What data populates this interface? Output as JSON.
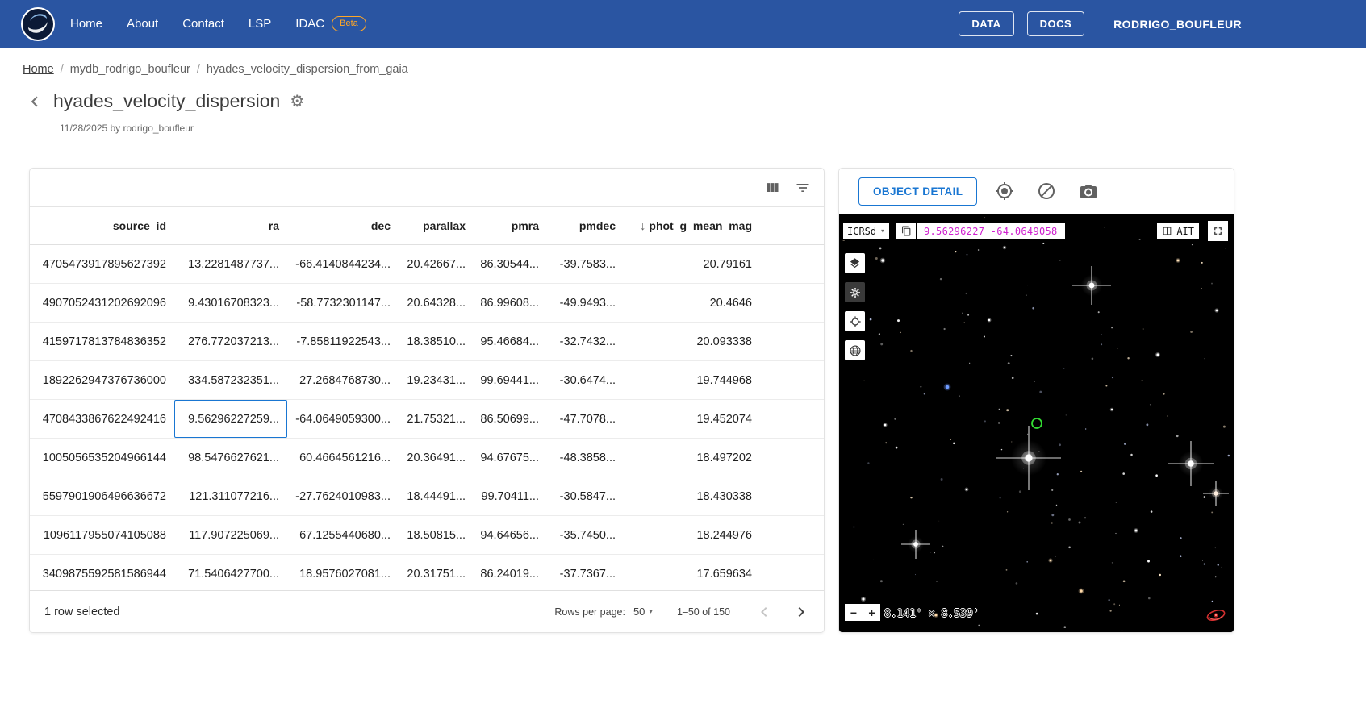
{
  "navbar": {
    "items": [
      {
        "label": "Home"
      },
      {
        "label": "About"
      },
      {
        "label": "Contact"
      },
      {
        "label": "LSP"
      },
      {
        "label": "IDAC",
        "badge": "Beta"
      }
    ],
    "actions": [
      {
        "label": "DATA"
      },
      {
        "label": "DOCS"
      }
    ],
    "user": "RODRIGO_BOUFLEUR"
  },
  "breadcrumb": {
    "separator": "/",
    "items": [
      {
        "label": "Home",
        "link": true
      },
      {
        "label": "mydb_rodrigo_boufleur"
      },
      {
        "label": "hyades_velocity_dispersion_from_gaia"
      }
    ]
  },
  "page": {
    "title": "hyades_velocity_dispersion",
    "date_author": "11/28/2025 by rodrigo_boufleur"
  },
  "table": {
    "columns": [
      {
        "field": "source_id",
        "label": "source_id"
      },
      {
        "field": "ra",
        "label": "ra"
      },
      {
        "field": "dec",
        "label": "dec"
      },
      {
        "field": "parallax",
        "label": "parallax"
      },
      {
        "field": "pmra",
        "label": "pmra"
      },
      {
        "field": "pmdec",
        "label": "pmdec"
      },
      {
        "field": "phot_g_mean_mag",
        "label": "phot_g_mean_mag",
        "sort": "desc"
      }
    ],
    "rows": [
      [
        "4705473917895627392",
        "13.2281487737...",
        "-66.4140844234...",
        "20.42667...",
        "86.30544...",
        "-39.7583...",
        "20.79161"
      ],
      [
        "4907052431202692096",
        "9.43016708323...",
        "-58.7732301147...",
        "20.64328...",
        "86.99608...",
        "-49.9493...",
        "20.4646"
      ],
      [
        "4159717813784836352",
        "276.772037213...",
        "-7.85811922543...",
        "18.38510...",
        "95.46684...",
        "-32.7432...",
        "20.093338"
      ],
      [
        "1892262947376736000",
        "334.587232351...",
        "27.2684768730...",
        "19.23431...",
        "99.69441...",
        "-30.6474...",
        "19.744968"
      ],
      [
        "4708433867622492416",
        "9.56296227259...",
        "-64.0649059300...",
        "21.75321...",
        "86.50699...",
        "-47.7078...",
        "19.452074"
      ],
      [
        "1005056535204966144",
        "98.5476627621...",
        "60.4664561216...",
        "20.36491...",
        "94.67675...",
        "-48.3858...",
        "18.497202"
      ],
      [
        "5597901906496636672",
        "121.311077216...",
        "-27.7624010983...",
        "18.44491...",
        "99.70411...",
        "-30.5847...",
        "18.430338"
      ],
      [
        "1096117955074105088",
        "117.907225069...",
        "67.1255440680...",
        "18.50815...",
        "94.64656...",
        "-35.7450...",
        "18.244976"
      ],
      [
        "3409875592581586944",
        "71.5406427700...",
        "18.9576027081...",
        "20.31751...",
        "86.24019...",
        "-37.7367...",
        "17.659634"
      ]
    ],
    "selected_cell": {
      "row_index": 4,
      "col_index": 1
    },
    "footer": {
      "selection_text": "1 row selected",
      "rows_per_page_label": "Rows per page:",
      "rows_per_page_value": "50",
      "range_text": "1–50 of 150"
    }
  },
  "viewer": {
    "detail_button": "OBJECT DETAIL",
    "frame_select": "ICRSd",
    "coordinates": "9.56296227 -64.0649058",
    "projection": "AIT",
    "fov_text": "8.141' × 8.539'",
    "zoom_out_label": "−",
    "zoom_in_label": "+",
    "marker_color": "#33dd33",
    "coordinate_color": "#d020d0"
  },
  "colors": {
    "navbar": "#2a55a2",
    "accent": "#1976d2",
    "beta_badge": "#ffa726"
  }
}
